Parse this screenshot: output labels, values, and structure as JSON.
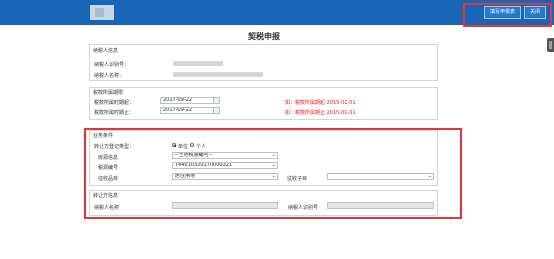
{
  "header": {
    "fill_button": "填写申报表",
    "close_button": "关闭"
  },
  "page_title": "契税申报",
  "taxpayer_info": {
    "section_title": "纳税人信息",
    "id_label": "纳税人识别号：",
    "name_label": "纳税人名称："
  },
  "tax_period": {
    "section_title": "税款所属期限",
    "start_label": "税款所属时期起：",
    "start_value": "2017-09-22",
    "end_label": "税款所属时期止：",
    "end_value": "2017-09-22",
    "start_hint": "如：税款所属期起 2015-01-01",
    "end_hint": "如：税款所属期止 2015-01-01"
  },
  "business": {
    "section_title": "业务条件",
    "transfer_type_label": "转让方登记类型：",
    "radio_unit": "单位",
    "radio_person": "个人",
    "land_info_label": "房源信息",
    "land_info_value": "--土地税源编号--",
    "land_code_label": "税源编号",
    "land_code_value": "T4401032017000032​1",
    "levy_item_label": "征收品目",
    "levy_item_value": "居住用地",
    "levy_subitem_label": "征收子目",
    "levy_subitem_value": ""
  },
  "transfer_party": {
    "section_title": "转让方信息",
    "name_label": "纳税人名称",
    "name_value": "",
    "id_label": "纳税人识别号",
    "id_value": ""
  },
  "colors": {
    "header_blue": "#1766b5",
    "highlight_red": "#e5343a",
    "hint_red": "#e01a1a"
  }
}
